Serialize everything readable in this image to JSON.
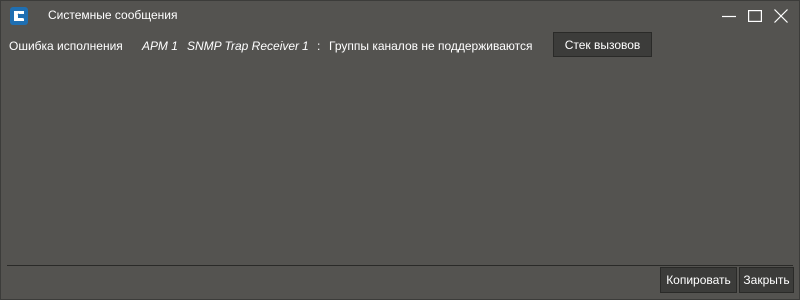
{
  "window": {
    "title": "Системные сообщения",
    "icon": "app-logo-icon"
  },
  "titlebar_controls": {
    "minimize_icon": "minimize-icon",
    "maximize_icon": "maximize-icon",
    "close_icon": "close-icon"
  },
  "message": {
    "type_label": "Ошибка исполнения",
    "workstation": "АРМ 1",
    "module": "SNMP Trap Receiver",
    "number": "1",
    "separator": ":",
    "text": "Группы каналов не поддерживаются",
    "stack_button_label": "Стек вызовов"
  },
  "footer": {
    "copy_label": "Копировать",
    "close_label": "Закрыть"
  },
  "colors": {
    "background": "#545350",
    "button_background": "#3c3c3a",
    "text": "#ffffff",
    "icon_accent": "#1f6fb2"
  }
}
